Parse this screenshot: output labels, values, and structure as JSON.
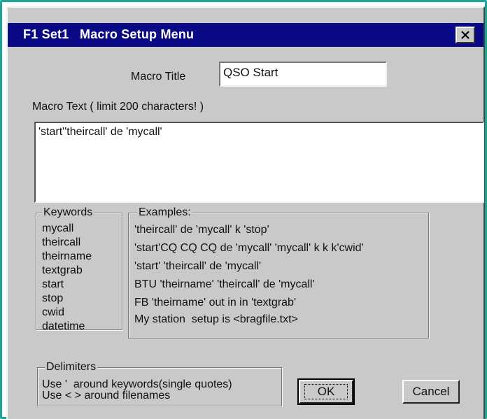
{
  "window": {
    "title": "F1 Set1   Macro Setup Menu",
    "close_glyph": "×"
  },
  "macro_title": {
    "label": "Macro Title",
    "value": "QSO Start"
  },
  "macro_text": {
    "label": "Macro Text ( limit 200 characters! )",
    "value": "'start''theircall' de 'mycall'"
  },
  "keywords": {
    "legend": "Keywords",
    "items": [
      "mycall",
      "theircall",
      "theirname",
      "textgrab",
      "start",
      "stop",
      "cwid",
      "datetime"
    ]
  },
  "examples": {
    "legend": "Examples:",
    "items": [
      "'theircall' de 'mycall' k 'stop'",
      "'start'CQ CQ CQ de 'mycall' 'mycall' k k k'cwid'",
      "'start' 'theircall' de 'mycall'",
      "BTU 'theirname' 'theircall' de 'mycall'",
      "FB 'theirname' out in in 'textgrab'",
      "My station  setup is <bragfile.txt>"
    ]
  },
  "delimiters": {
    "legend": "Delimiters",
    "lines": [
      "Use '  around keywords(single quotes)",
      "Use < > around filenames"
    ]
  },
  "buttons": {
    "ok": "OK",
    "cancel": "Cancel"
  },
  "colors": {
    "frame": "#1aa79a",
    "titlebar": "#0a0a86",
    "dialog_bg": "#c9c9c9"
  }
}
